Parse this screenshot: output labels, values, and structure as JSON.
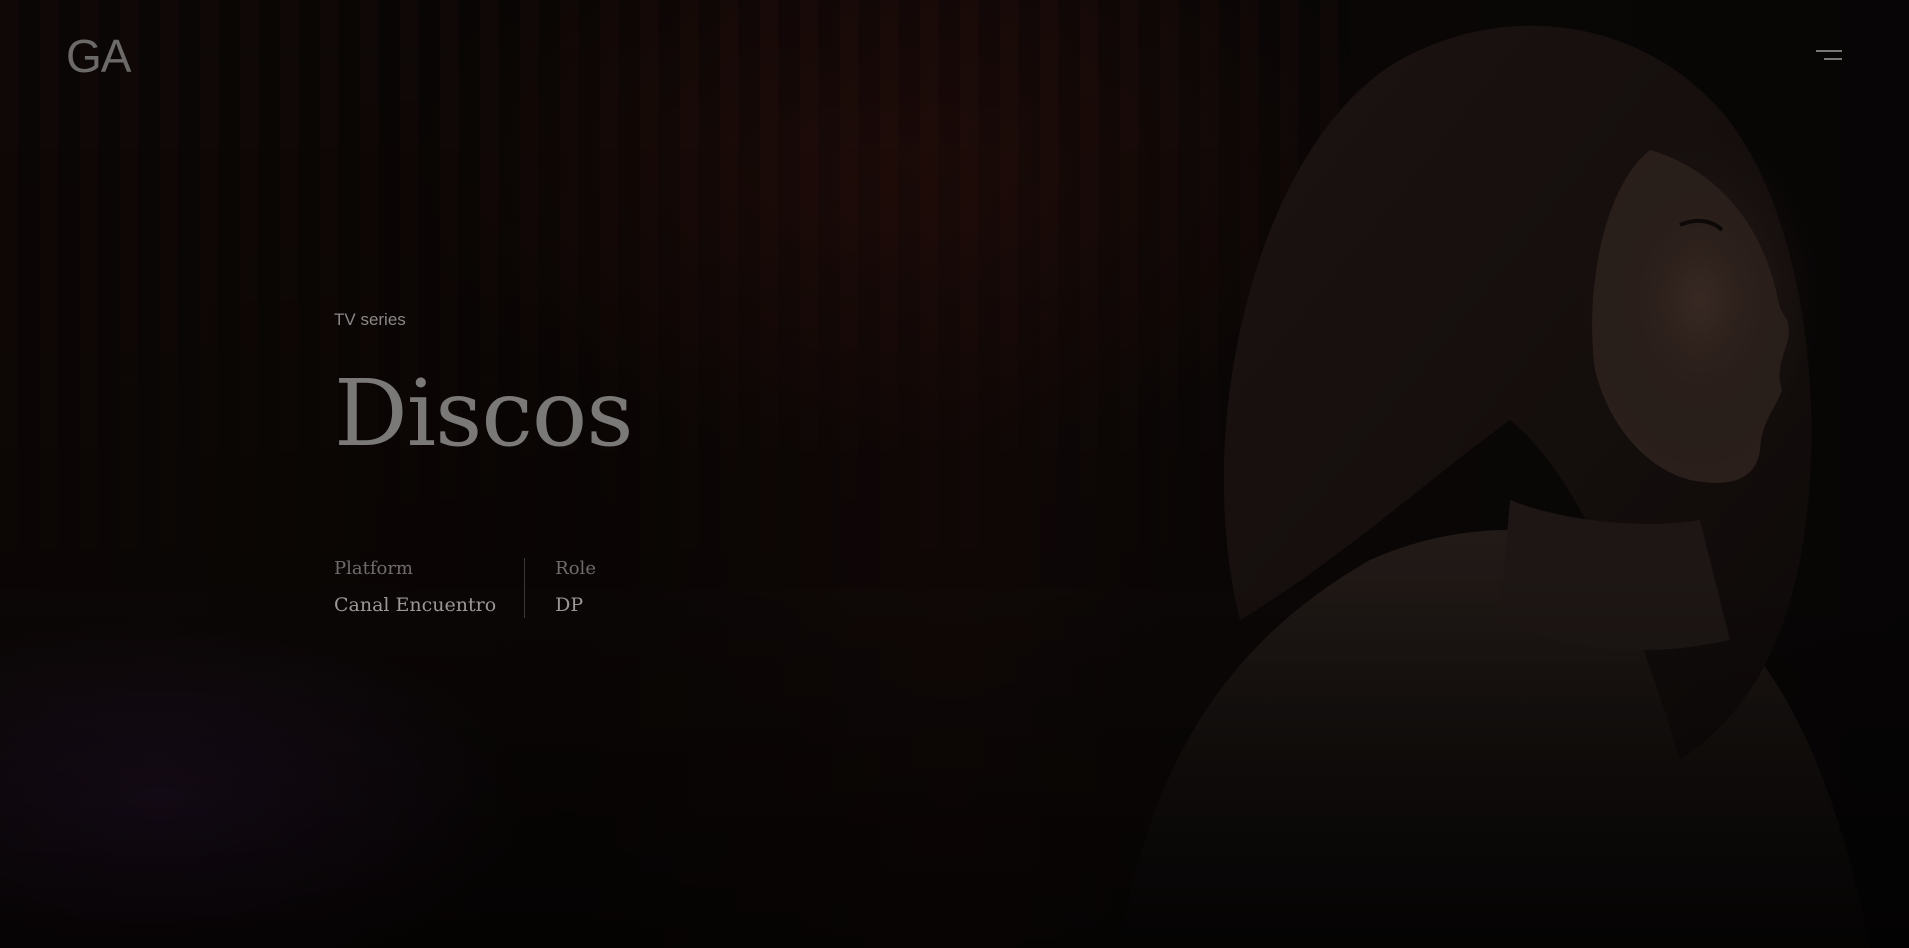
{
  "header": {
    "logo_text": "GA",
    "menu_icon": "hamburger-menu-icon"
  },
  "project": {
    "category": "TV series",
    "title": "Discos",
    "details": [
      {
        "label": "Platform",
        "value": "Canal Encuentro"
      },
      {
        "label": "Role",
        "value": "DP"
      }
    ]
  },
  "colors": {
    "background": "#050404",
    "logo": "#6c6a69",
    "title": "#7b7978",
    "label": "#6f6c6b",
    "value": "#9a9796",
    "divider": "#3a3737"
  }
}
